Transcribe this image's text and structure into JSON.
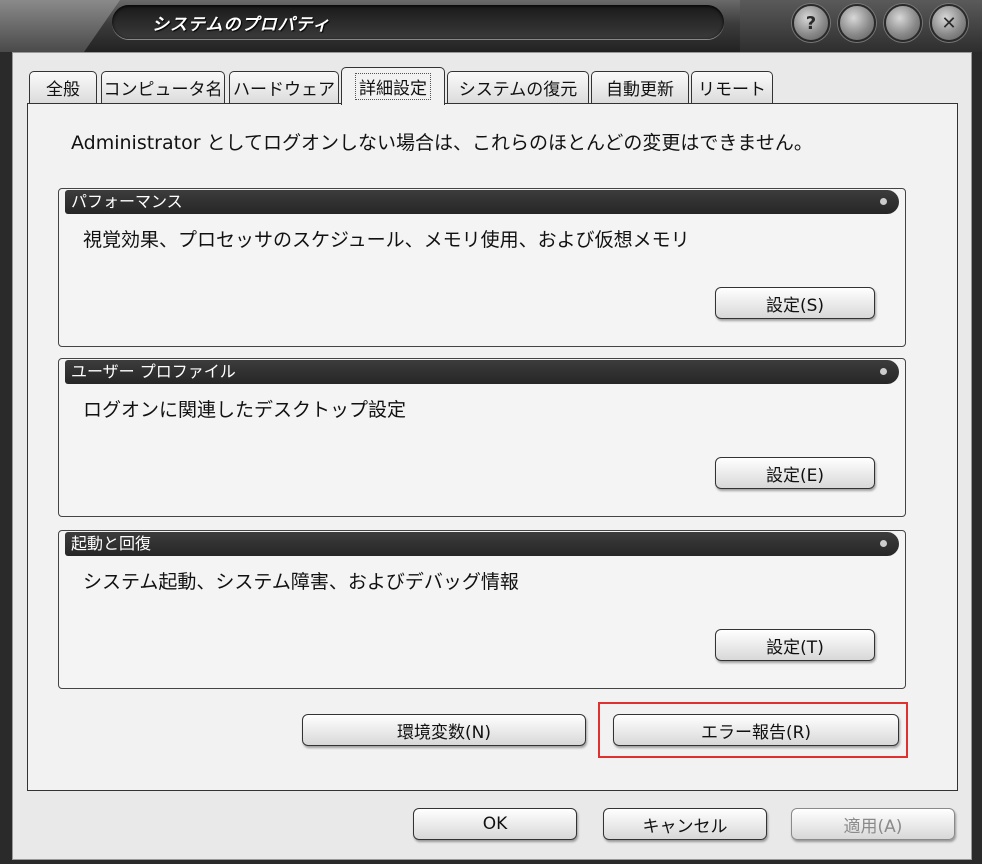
{
  "window": {
    "title": "システムのプロパティ"
  },
  "tabs": [
    {
      "label": "全般"
    },
    {
      "label": "コンピュータ名"
    },
    {
      "label": "ハードウェア"
    },
    {
      "label": "詳細設定"
    },
    {
      "label": "システムの復元"
    },
    {
      "label": "自動更新"
    },
    {
      "label": "リモート"
    }
  ],
  "panel": {
    "notice": "Administrator としてログオンしない場合は、これらのほとんどの変更はできません。",
    "groups": [
      {
        "title": "パフォーマンス",
        "description": "視覚効果、プロセッサのスケジュール、メモリ使用、および仮想メモリ",
        "button": "設定(S)"
      },
      {
        "title": "ユーザー プロファイル",
        "description": "ログオンに関連したデスクトップ設定",
        "button": "設定(E)"
      },
      {
        "title": "起動と回復",
        "description": "システム起動、システム障害、およびデバッグ情報",
        "button": "設定(T)"
      }
    ],
    "env_button": "環境変数(N)",
    "error_button": "エラー報告(R)"
  },
  "footer": {
    "ok": "OK",
    "cancel": "キャンセル",
    "apply": "適用(A)"
  },
  "colors": {
    "highlight": "#e03131",
    "group_header": "#2e2e2e",
    "panel_bg": "#f2f2f2"
  }
}
